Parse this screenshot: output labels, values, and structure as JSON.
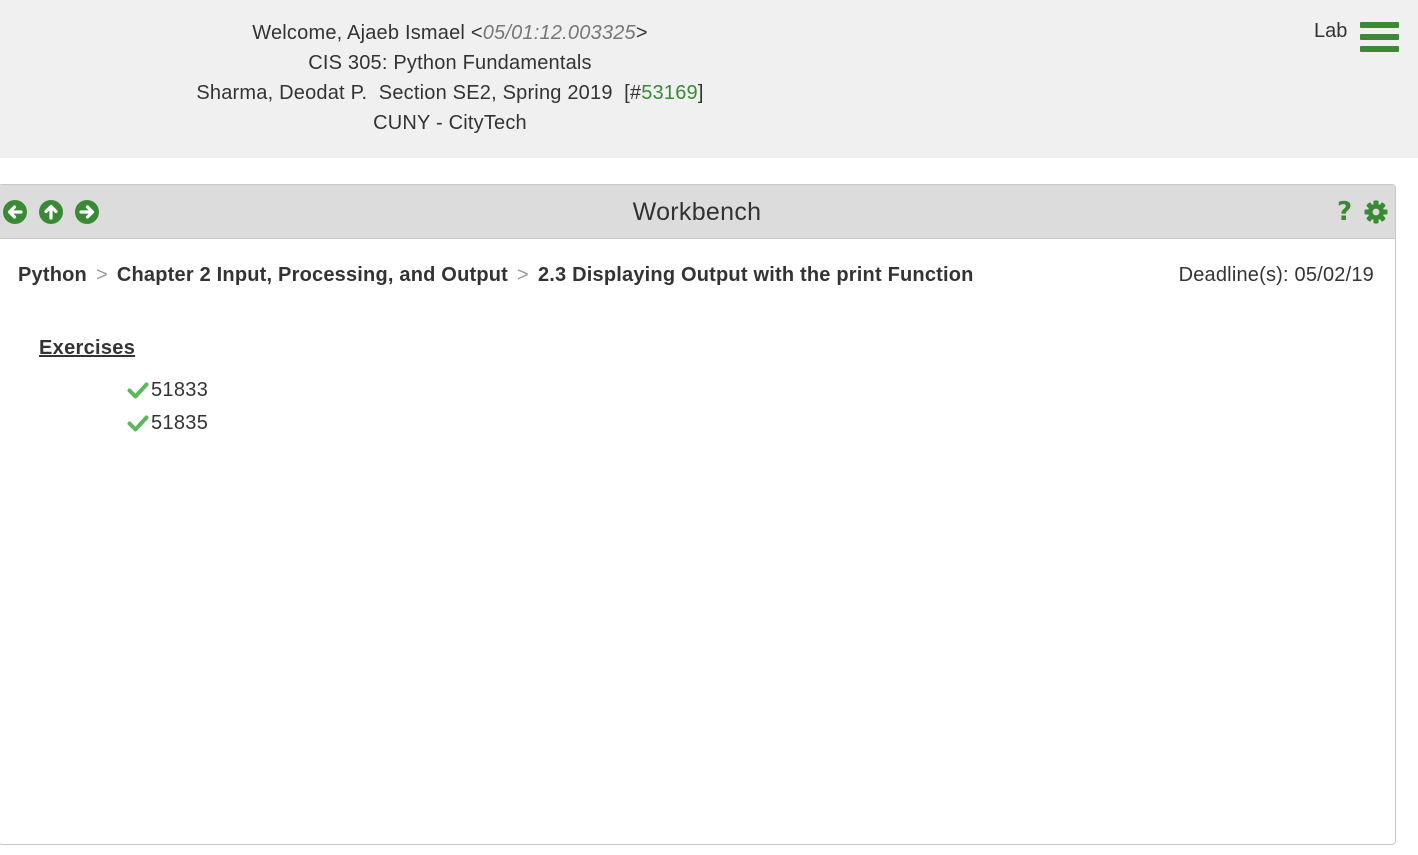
{
  "header": {
    "welcome_prefix": "Welcome, Ajaeb Ismael <",
    "timestamp": "05/01:12.003325",
    "welcome_suffix": ">",
    "course": "CIS 305: Python Fundamentals",
    "section_prefix": "Sharma, Deodat P.  Section SE2, Spring 2019  [#",
    "section_id": "53169",
    "section_suffix": "]",
    "institution": "CUNY - CityTech",
    "lab_label": "Lab",
    "menu_icon": "hamburger-icon"
  },
  "panel": {
    "title": "Workbench",
    "nav_icons": [
      "arrow-left-circle-icon",
      "arrow-up-circle-icon",
      "arrow-right-circle-icon"
    ],
    "help_label": "?",
    "settings_icon": "gear-icon"
  },
  "breadcrumb": {
    "items": [
      "Python",
      "Chapter 2 Input, Processing, and Output",
      "2.3 Displaying Output with the print Function"
    ],
    "separator": ">"
  },
  "deadline": "Deadline(s): 05/02/19",
  "exercises": {
    "heading": "Exercises",
    "items": [
      {
        "id": "51833",
        "status": "completed"
      },
      {
        "id": "51835",
        "status": "completed"
      }
    ]
  },
  "colors": {
    "accent": "#3a8a35",
    "check": "#5cb85c",
    "header_bg": "#f0f0f0",
    "bar_bg": "#dcdcdc"
  }
}
